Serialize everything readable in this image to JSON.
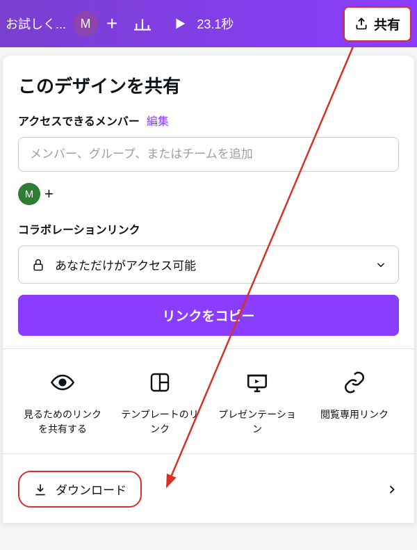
{
  "topbar": {
    "trial_text": "お試しく...",
    "avatar_initial": "M",
    "duration": "23.1秒",
    "share_label": "共有"
  },
  "panel": {
    "title": "このデザインを共有",
    "access_label": "アクセスできるメンバー",
    "edit_link": "編集",
    "member_placeholder": "メンバー、グループ、またはチームを追加",
    "member_avatar": "M",
    "collab_label": "コラボレーションリンク",
    "access_select_text": "あなただけがアクセス可能",
    "copy_btn": "リンクをコピー",
    "options": [
      {
        "label": "見るためのリンクを共有する"
      },
      {
        "label": "テンプレートのリンク"
      },
      {
        "label": "プレゼンテーション"
      },
      {
        "label": "閲覧専用リンク"
      }
    ],
    "download_label": "ダウンロード"
  }
}
